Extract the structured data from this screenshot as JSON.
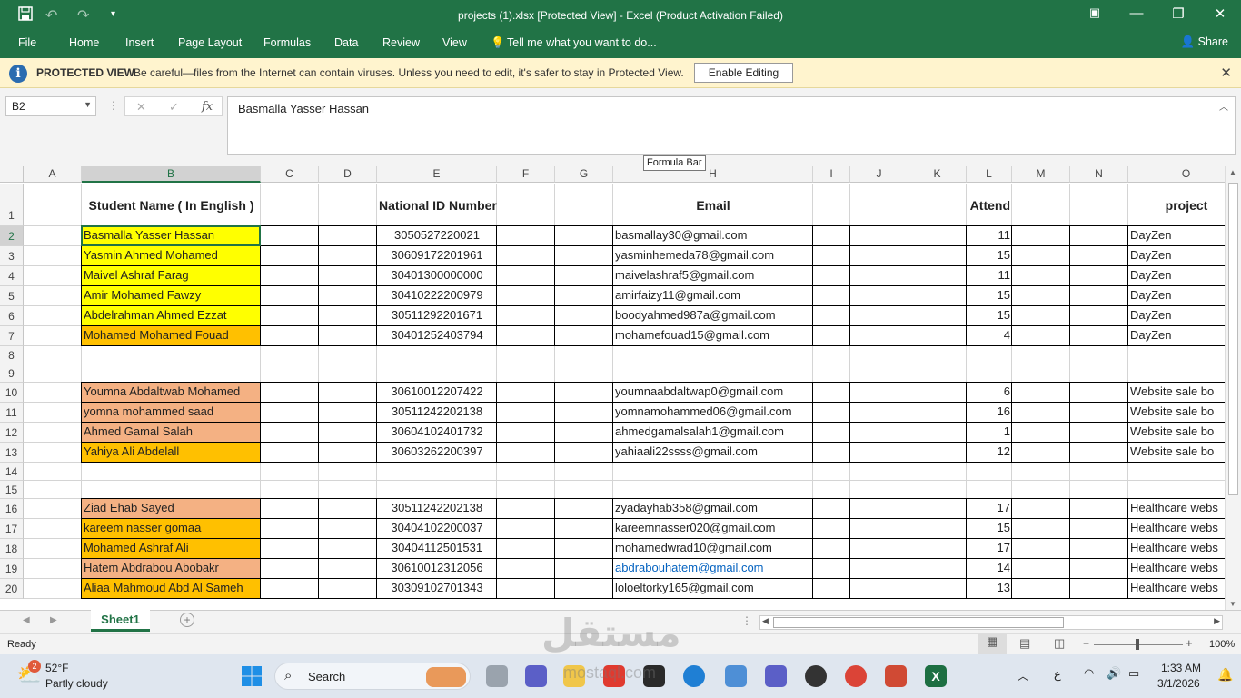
{
  "titlebar": {
    "title": "projects (1).xlsx  [Protected View] - Excel (Product Activation Failed)",
    "save_icon": "save-icon",
    "undo_icon": "undo-icon",
    "redo_icon": "redo-icon"
  },
  "menu": {
    "file": "File",
    "home": "Home",
    "insert": "Insert",
    "page_layout": "Page Layout",
    "formulas": "Formulas",
    "data": "Data",
    "review": "Review",
    "view": "View",
    "tell_me": "Tell me what you want to do...",
    "share": "Share"
  },
  "protected_view": {
    "title": "PROTECTED VIEW",
    "message": "Be careful—files from the Internet can contain viruses. Unless you need to edit, it's safer to stay in Protected View.",
    "enable_button": "Enable Editing"
  },
  "formula_bar": {
    "name_box": "B2",
    "fx": "fx",
    "value": "Basmalla Yasser Hassan",
    "tooltip": "Formula Bar"
  },
  "columns": [
    "A",
    "B",
    "C",
    "D",
    "E",
    "F",
    "G",
    "H",
    "I",
    "J",
    "K",
    "L",
    "M",
    "N",
    "O"
  ],
  "row_numbers": [
    "1",
    "2",
    "3",
    "4",
    "5",
    "6",
    "7",
    "8",
    "9",
    "10",
    "11",
    "12",
    "13",
    "14",
    "15",
    "16",
    "17",
    "18",
    "19",
    "20"
  ],
  "headers": {
    "name": "Student Name ( In English )",
    "nid": "National ID Number",
    "email": "Email",
    "attend": "Attend",
    "project": "project"
  },
  "rows": [
    {
      "row": "2",
      "name": "Basmalla Yasser Hassan",
      "nid": "3050527220021",
      "email": "basmallay30@gmail.com",
      "attend": "11",
      "project": "DayZen",
      "color": "#ffff00"
    },
    {
      "row": "3",
      "name": "Yasmin Ahmed Mohamed",
      "nid": "30609172201961",
      "email": "yasminhemeda78@gmail.com",
      "attend": "15",
      "project": "DayZen",
      "color": "#ffff00"
    },
    {
      "row": "4",
      "name": "Maivel Ashraf Farag",
      "nid": "30401300000000",
      "email": "maivelashraf5@gmail.com",
      "attend": "11",
      "project": "DayZen",
      "color": "#ffff00"
    },
    {
      "row": "5",
      "name": "Amir Mohamed Fawzy",
      "nid": "30410222200979",
      "email": "amirfaizy11@gmail.com",
      "attend": "15",
      "project": "DayZen",
      "color": "#ffff00"
    },
    {
      "row": "6",
      "name": "Abdelrahman Ahmed Ezzat",
      "nid": "30511292201671",
      "email": "boodyahmed987a@gmail.com",
      "attend": "15",
      "project": "DayZen",
      "color": "#ffff00"
    },
    {
      "row": "7",
      "name": "Mohamed Mohamed Fouad",
      "nid": "30401252403794",
      "email": "mohamefouad15@gmail.com",
      "attend": "4",
      "project": "DayZen",
      "color": "#ffc000"
    },
    {
      "row": "10",
      "name": "Youmna Abdaltwab Mohamed",
      "nid": "30610012207422",
      "email": "youmnaabdaltwap0@gmail.com",
      "attend": "6",
      "project": "Website sale bo",
      "color": "#f4b183"
    },
    {
      "row": "11",
      "name": "yomna mohammed saad",
      "nid": "30511242202138",
      "email": "yomnamohammed06@gmail.com",
      "attend": "16",
      "project": "Website sale bo",
      "color": "#f4b183"
    },
    {
      "row": "12",
      "name": "Ahmed Gamal Salah",
      "nid": "30604102401732",
      "email": "ahmedgamalsalah1@gmail.com",
      "attend": "1",
      "project": "Website sale bo",
      "color": "#f4b183"
    },
    {
      "row": "13",
      "name": "Yahiya Ali Abdelall",
      "nid": "30603262200397",
      "email": "yahiaali22ssss@gmail.com",
      "attend": "12",
      "project": "Website sale bo",
      "color": "#ffc000"
    },
    {
      "row": "16",
      "name": "Ziad Ehab Sayed",
      "nid": "30511242202138",
      "email": "zyadayhab358@gmail.com",
      "attend": "17",
      "project": "Healthcare webs",
      "color": "#f4b183"
    },
    {
      "row": "17",
      "name": "kareem nasser gomaa",
      "nid": "30404102200037",
      "email": "kareemnasser020@gmail.com",
      "attend": "15",
      "project": "Healthcare webs",
      "color": "#ffc000"
    },
    {
      "row": "18",
      "name": "Mohamed Ashraf Ali",
      "nid": "30404112501531",
      "email": "mohamedwrad10@gmail.com",
      "attend": "17",
      "project": "Healthcare webs",
      "color": "#ffc000"
    },
    {
      "row": "19",
      "name": "Hatem Abdrabou Abobakr",
      "nid": "30610012312056",
      "email": "abdrabouhatem@gmail.com",
      "attend": "14",
      "project": "Healthcare webs",
      "color": "#f4b183",
      "link": true
    },
    {
      "row": "20",
      "name": "Aliaa Mahmoud Abd Al Sameh",
      "nid": "30309102701343",
      "email": "loloeltorky165@gmail.com",
      "attend": "13",
      "project": "Healthcare webs",
      "color": "#ffc000"
    }
  ],
  "sheet_tab": "Sheet1",
  "status": {
    "ready": "Ready",
    "zoom": "100%"
  },
  "taskbar": {
    "weather_temp": "52°F",
    "weather_desc": "Partly cloudy",
    "weather_badge": "2",
    "search": "Search",
    "time": "1:33 AM",
    "date": "3/1/2026",
    "lang": "ع"
  },
  "watermark": {
    "arabic": "مستقل",
    "latin": "mostaql.com"
  }
}
